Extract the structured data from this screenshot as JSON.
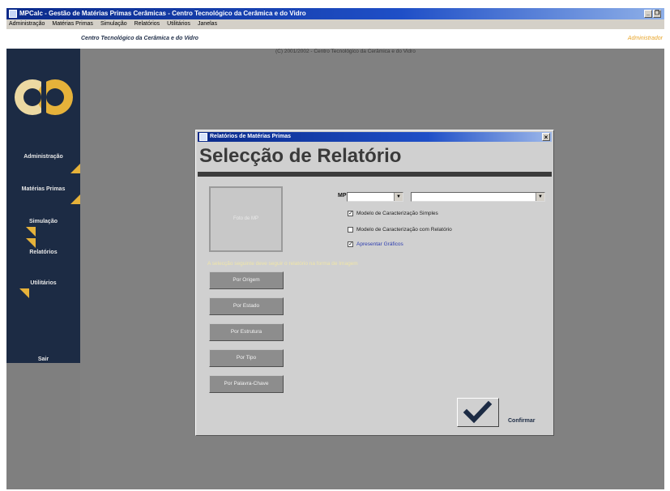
{
  "window": {
    "title": "MPCalc - Gestão de Matérias Primas Cerâmicas  - Centro Tecnológico da Cerâmica e do Vidro",
    "minimize": "_",
    "restore": "❐",
    "close": "×"
  },
  "menu": [
    "Administração",
    "Matérias Primas",
    "Simulação",
    "Relatórios",
    "Utilitários",
    "Janelas"
  ],
  "infobar": {
    "center_name": "Centro Tecnológico da Cerâmica e do Vidro",
    "user": "Administrador"
  },
  "status_text": "(C) 2001/2002 - Centro Tecnológico da Cerâmica e do Vidro",
  "sidebar": {
    "items": [
      "Administração",
      "Matérias Primas",
      "Simulação",
      "Relatórios",
      "Utilitários",
      "Sair"
    ]
  },
  "dialog": {
    "title": "Relatórios de Matérias Primas",
    "close": "×",
    "heading": "Selecção de Relatório",
    "photo_label": "Foto de MP",
    "mp_label": "MP",
    "checkboxes": [
      {
        "label": "Modelo de Caracterização Simples",
        "checked": true
      },
      {
        "label": "Modelo de Caracterização com Relatório",
        "checked": false
      },
      {
        "label": "Apresentar Gráficos",
        "checked": true
      }
    ],
    "hint": "A selecção seguinte deve seguir o relatório na forma de Imagem",
    "report_buttons": [
      "Por Origem",
      "Por Estado",
      "Por Estrutura",
      "Por Tipo",
      "Por Palavra-Chave"
    ],
    "confirm_label": "Confirmar",
    "check_mark": "✓",
    "combo_arrow": "▼"
  },
  "colors": {
    "sidebar": "#1c2b44",
    "accent_flap": "#e6b23a",
    "desktop": "#818181"
  }
}
